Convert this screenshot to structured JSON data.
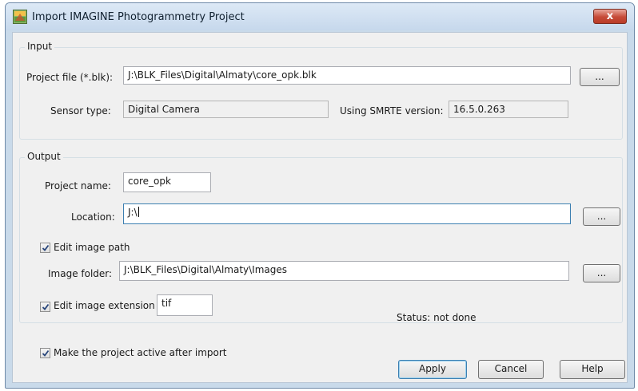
{
  "window": {
    "title": "Import IMAGINE Photogrammetry Project",
    "close_symbol": "x"
  },
  "input_group": {
    "legend": "Input",
    "project_file_label": "Project file (*.blk):",
    "project_file_value": "J:\\BLK_Files\\Digital\\Almaty\\core_opk.blk",
    "browse_label": "...",
    "sensor_type_label": "Sensor type:",
    "sensor_type_value": "Digital Camera",
    "smrte_label": "Using SMRTE version:",
    "smrte_value": "16.5.0.263"
  },
  "output_group": {
    "legend": "Output",
    "project_name_label": "Project name:",
    "project_name_value": "core_opk",
    "location_label": "Location:",
    "location_value": "J:\\",
    "location_browse_label": "...",
    "edit_image_path_label": "Edit image path",
    "edit_image_path_checked": true,
    "image_folder_label": "Image folder:",
    "image_folder_value": "J:\\BLK_Files\\Digital\\Almaty\\Images",
    "image_folder_browse_label": "...",
    "edit_image_extension_label": "Edit image extension",
    "edit_image_extension_checked": true,
    "image_extension_value": "tif",
    "status_text": "Status: not done"
  },
  "footer": {
    "make_active_label": "Make the project active after import",
    "make_active_checked": true,
    "apply_label": "Apply",
    "cancel_label": "Cancel",
    "help_label": "Help"
  },
  "colors": {
    "titlebar": "#c6d8ec",
    "close_button": "#c64a37",
    "dialog_background": "#f0f0f0",
    "default_button_border": "#3c7fb1"
  }
}
